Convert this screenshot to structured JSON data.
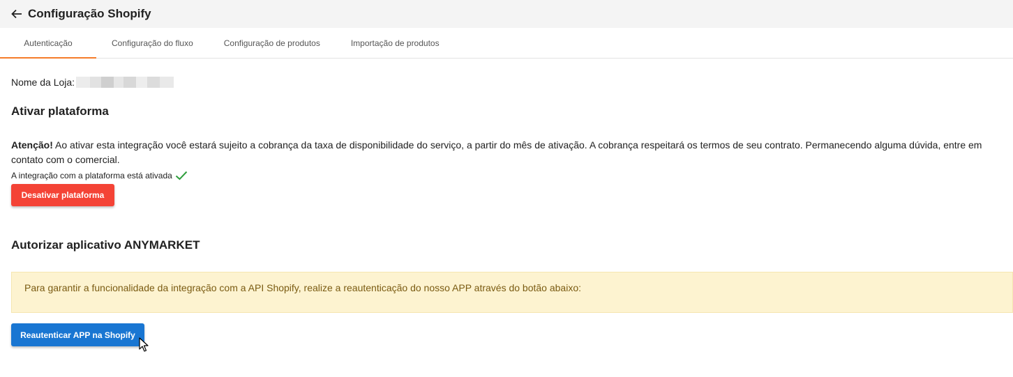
{
  "header": {
    "title": "Configuração Shopify",
    "back_icon": "arrow-left-icon"
  },
  "tabs": [
    {
      "label": "Autenticação",
      "active": true
    },
    {
      "label": "Configuração do fluxo",
      "active": false
    },
    {
      "label": "Configuração de produtos",
      "active": false
    },
    {
      "label": "Importação de produtos",
      "active": false
    }
  ],
  "store": {
    "label": "Nome da Loja:"
  },
  "activate": {
    "title": "Ativar plataforma",
    "warning_bold": "Atenção!",
    "warning_text": " Ao ativar esta integração você estará sujeito a cobrança da taxa de disponibilidade do serviço, a partir do mês de ativação. A cobrança respeitará os termos de seu contrato. Permanecendo alguma dúvida, entre em contato com o comercial.",
    "status_text": "A integração com a plataforma está ativada",
    "status_icon": "check-icon",
    "deactivate_button": "Desativar plataforma"
  },
  "authorize": {
    "title": "Autorizar aplicativo ANYMARKET",
    "alert_text": "Para garantir a funcionalidade da integração com a API Shopify, realize a reautenticação do nosso APP através do botão abaixo:",
    "reauth_button": "Reautenticar APP na Shopify"
  },
  "colors": {
    "accent_tab": "#f57c2a",
    "danger": "#f44336",
    "primary": "#1976d2",
    "success": "#2e9e3c",
    "alert_bg": "#fdf3d0",
    "alert_text": "#7a5b12"
  }
}
